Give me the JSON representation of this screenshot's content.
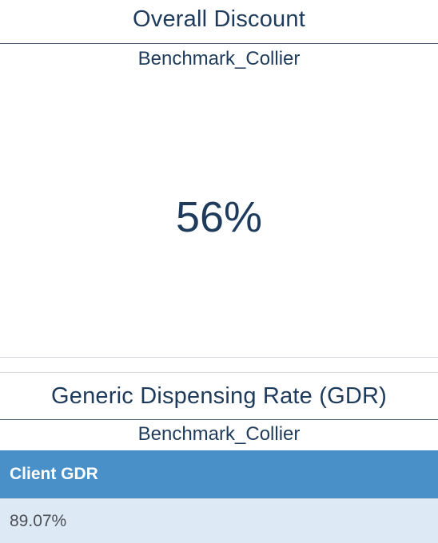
{
  "overall_discount": {
    "title": "Overall Discount",
    "subtitle": "Benchmark_Collier",
    "value": "56%"
  },
  "gdr": {
    "title": "Generic Dispensing Rate (GDR)",
    "subtitle": "Benchmark_Collier",
    "table": {
      "header": "Client GDR",
      "rows": [
        "89.07%"
      ]
    }
  },
  "colors": {
    "title_text": "#1f3b5c",
    "table_header_bg": "#4a90c8",
    "table_row_bg": "#dde9f4",
    "row_text": "#4a4f55"
  }
}
